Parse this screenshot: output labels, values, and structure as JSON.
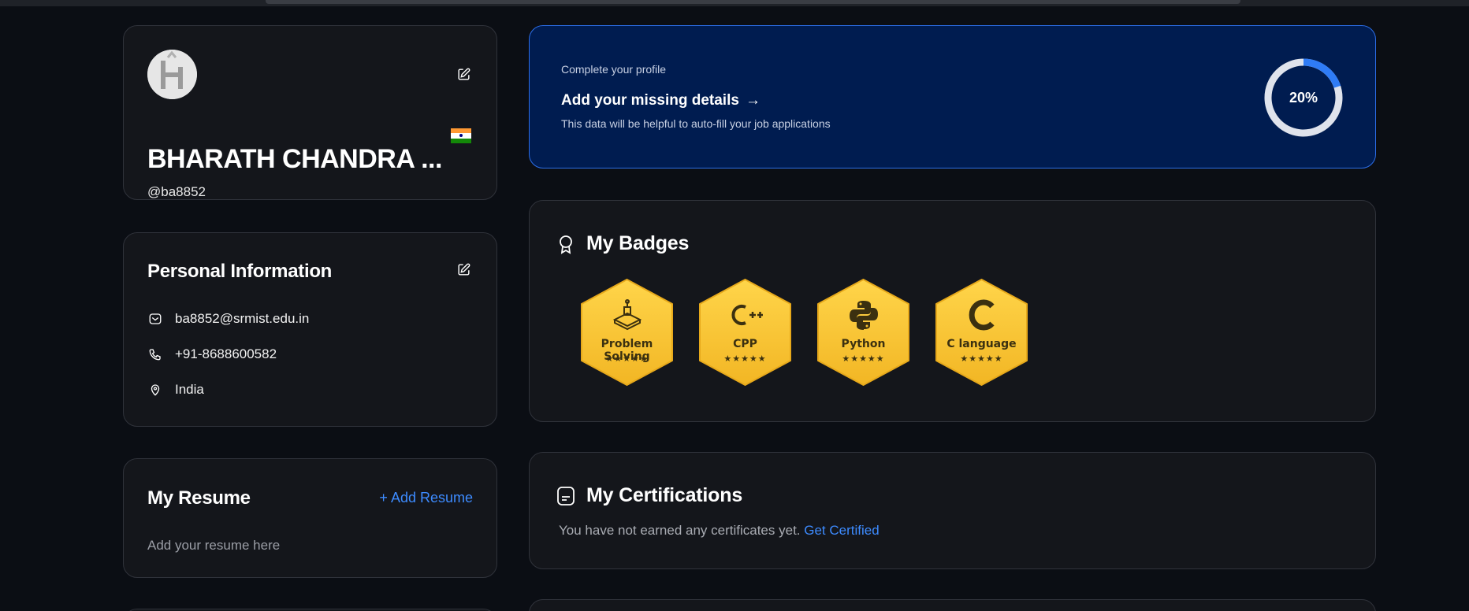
{
  "profile": {
    "name": "BHARATH CHANDRA ...",
    "handle": "@ba8852",
    "country_flag": "india-flag",
    "avatar_letter": "H"
  },
  "personal": {
    "title": "Personal Information",
    "email": "ba8852@srmist.edu.in",
    "phone": "+91-8688600582",
    "location": "India"
  },
  "resume": {
    "title": "My Resume",
    "add_label": "+ Add Resume",
    "hint": "Add your resume here"
  },
  "complete_profile": {
    "kicker": "Complete your profile",
    "link": "Add your missing details",
    "arrow": "→",
    "subtitle": "This data will be helpful to auto-fill your job applications",
    "progress_label": "20%",
    "progress": 0.2
  },
  "badges": {
    "title": "My Badges",
    "items": [
      {
        "label": "Problem Solving",
        "stars": "★★★★★",
        "icon": "problem-solving-icon"
      },
      {
        "label": "CPP",
        "stars": "★★★★★",
        "icon": "cpp-icon"
      },
      {
        "label": "Python",
        "stars": "★★★★★",
        "icon": "python-icon"
      },
      {
        "label": "C language",
        "stars": "★★★★★",
        "icon": "c-language-icon"
      }
    ]
  },
  "certifications": {
    "title": "My Certifications",
    "empty_text": "You have not earned any certificates yet.",
    "link": "Get Certified"
  },
  "colors": {
    "background": "#0b0e14",
    "card": "#14161b",
    "accent_blue": "#3d8bff",
    "profile_banner": "#001c50",
    "badge_gold": "#f7c12f"
  }
}
